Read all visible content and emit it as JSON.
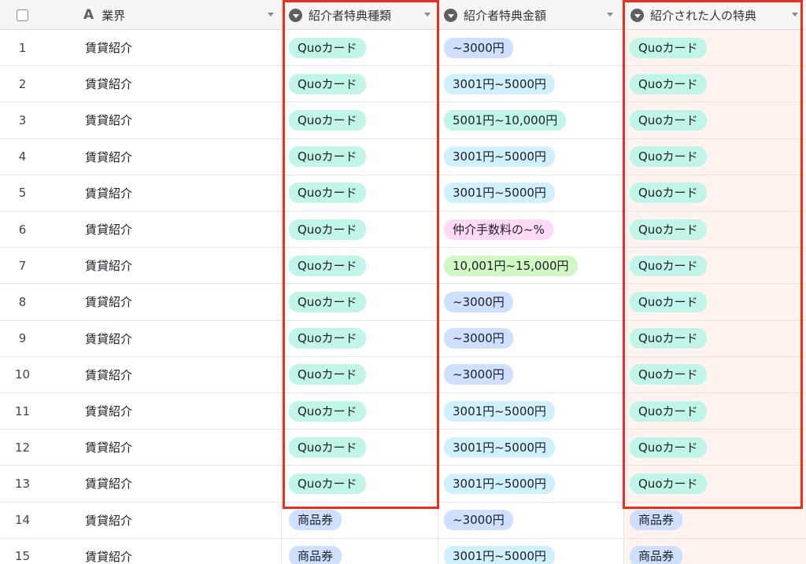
{
  "header": {
    "industry": "業界",
    "referrer_type": "紹介者特典種類",
    "referrer_amount": "紹介者特典金額",
    "referee_benefit": "紹介された人の特典"
  },
  "icons": {
    "checkbox": "checkbox-icon",
    "text_field": "text-field-icon",
    "single_select": "single-select-icon",
    "dropdown": "dropdown-arrow-icon"
  },
  "colors": {
    "highlight_border": "#e8301c",
    "highlight_tint": "#fff3f0",
    "pill_quo": "#c2f5e9",
    "pill_under3000": "#cfdfff",
    "pill_3001_5000": "#d0f0fd",
    "pill_5001_10000": "#c2f5e9",
    "pill_percent": "#ffdaf6",
    "pill_10001_15000": "#d1f7c4",
    "pill_shohinken": "#cfdfff"
  },
  "rows": [
    {
      "num": "1",
      "industry": "賃貸紹介",
      "type": "Quoカード",
      "type_color": "c-quo",
      "amount": "~3000円",
      "amount_color": "c-s3000",
      "benefit": "Quoカード",
      "benefit_color": "c-quo"
    },
    {
      "num": "2",
      "industry": "賃貸紹介",
      "type": "Quoカード",
      "type_color": "c-quo",
      "amount": "3001円~5000円",
      "amount_color": "c-3001",
      "benefit": "Quoカード",
      "benefit_color": "c-quo"
    },
    {
      "num": "3",
      "industry": "賃貸紹介",
      "type": "Quoカード",
      "type_color": "c-quo",
      "amount": "5001円~10,000円",
      "amount_color": "c-5001",
      "benefit": "Quoカード",
      "benefit_color": "c-quo"
    },
    {
      "num": "4",
      "industry": "賃貸紹介",
      "type": "Quoカード",
      "type_color": "c-quo",
      "amount": "3001円~5000円",
      "amount_color": "c-3001",
      "benefit": "Quoカード",
      "benefit_color": "c-quo"
    },
    {
      "num": "5",
      "industry": "賃貸紹介",
      "type": "Quoカード",
      "type_color": "c-quo",
      "amount": "3001円~5000円",
      "amount_color": "c-3001",
      "benefit": "Quoカード",
      "benefit_color": "c-quo"
    },
    {
      "num": "6",
      "industry": "賃貸紹介",
      "type": "Quoカード",
      "type_color": "c-quo",
      "amount": "仲介手数料の~%",
      "amount_color": "c-pct",
      "benefit": "Quoカード",
      "benefit_color": "c-quo"
    },
    {
      "num": "7",
      "industry": "賃貸紹介",
      "type": "Quoカード",
      "type_color": "c-quo",
      "amount": "10,001円~15,000円",
      "amount_color": "c-10001",
      "benefit": "Quoカード",
      "benefit_color": "c-quo"
    },
    {
      "num": "8",
      "industry": "賃貸紹介",
      "type": "Quoカード",
      "type_color": "c-quo",
      "amount": "~3000円",
      "amount_color": "c-s3000",
      "benefit": "Quoカード",
      "benefit_color": "c-quo"
    },
    {
      "num": "9",
      "industry": "賃貸紹介",
      "type": "Quoカード",
      "type_color": "c-quo",
      "amount": "~3000円",
      "amount_color": "c-s3000",
      "benefit": "Quoカード",
      "benefit_color": "c-quo"
    },
    {
      "num": "10",
      "industry": "賃貸紹介",
      "type": "Quoカード",
      "type_color": "c-quo",
      "amount": "~3000円",
      "amount_color": "c-s3000",
      "benefit": "Quoカード",
      "benefit_color": "c-quo"
    },
    {
      "num": "11",
      "industry": "賃貸紹介",
      "type": "Quoカード",
      "type_color": "c-quo",
      "amount": "3001円~5000円",
      "amount_color": "c-3001",
      "benefit": "Quoカード",
      "benefit_color": "c-quo"
    },
    {
      "num": "12",
      "industry": "賃貸紹介",
      "type": "Quoカード",
      "type_color": "c-quo",
      "amount": "3001円~5000円",
      "amount_color": "c-3001",
      "benefit": "Quoカード",
      "benefit_color": "c-quo"
    },
    {
      "num": "13",
      "industry": "賃貸紹介",
      "type": "Quoカード",
      "type_color": "c-quo",
      "amount": "3001円~5000円",
      "amount_color": "c-3001",
      "benefit": "Quoカード",
      "benefit_color": "c-quo"
    },
    {
      "num": "14",
      "industry": "賃貸紹介",
      "type": "商品券",
      "type_color": "c-shohin",
      "amount": "~3000円",
      "amount_color": "c-s3000",
      "benefit": "商品券",
      "benefit_color": "c-shohin"
    },
    {
      "num": "15",
      "industry": "賃貸紹介",
      "type": "商品券",
      "type_color": "c-shohin",
      "amount": "3001円~5000円",
      "amount_color": "c-3001",
      "benefit": "商品券",
      "benefit_color": "c-shohin"
    }
  ]
}
